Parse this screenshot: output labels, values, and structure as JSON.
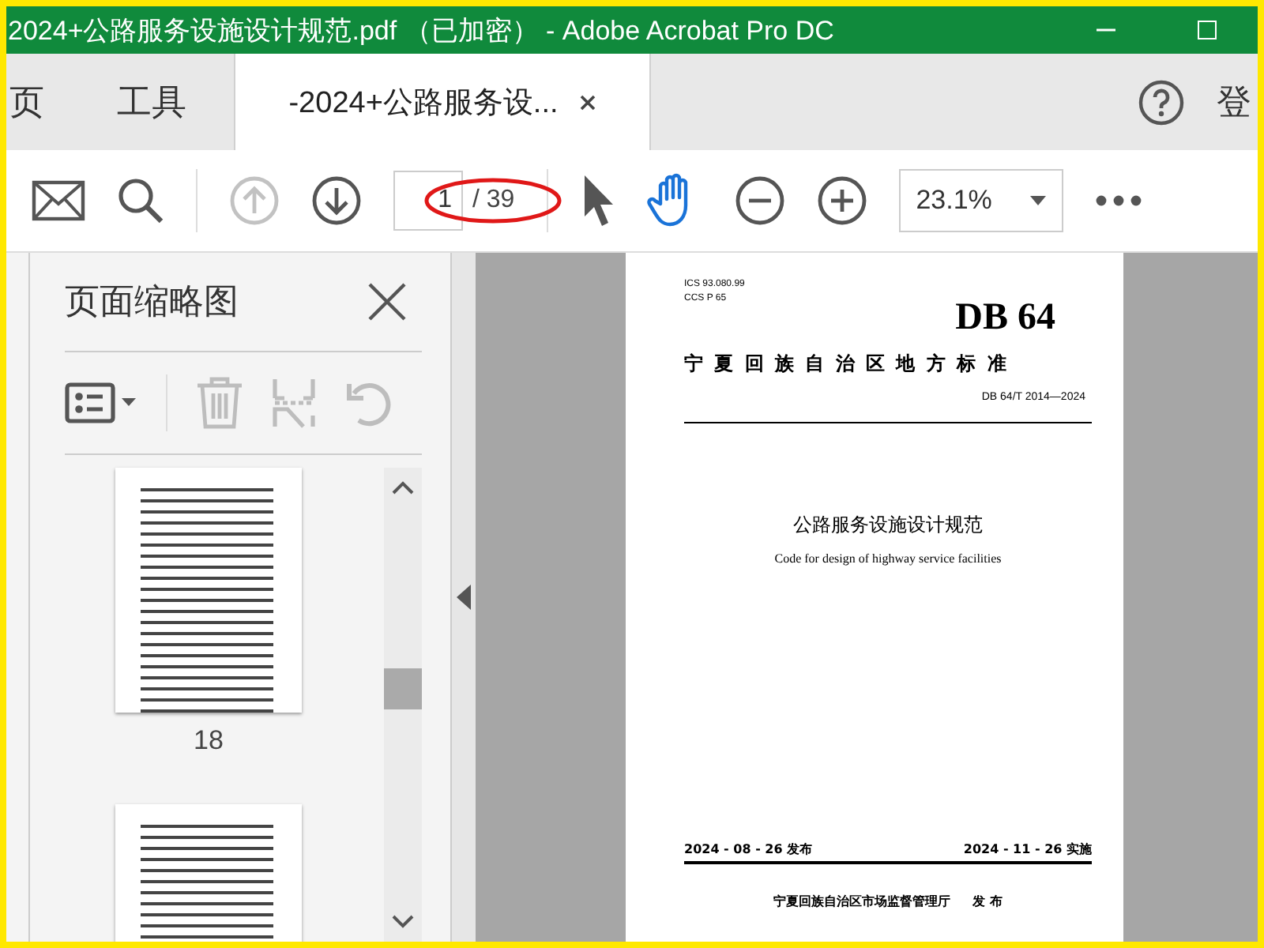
{
  "window": {
    "title": "2024+公路服务设施设计规范.pdf （已加密） - Adobe Acrobat Pro DC"
  },
  "tabs": [
    {
      "label": "页",
      "kind": "nav",
      "selected": false
    },
    {
      "label": "工具",
      "kind": "nav",
      "selected": false
    },
    {
      "label": "-2024+公路服务设...",
      "kind": "doc",
      "selected": true
    }
  ],
  "account_label": "登",
  "toolbar": {
    "prev_page_disabled": true,
    "page_field": {
      "value": "1"
    },
    "page_count": "/ 39",
    "hand_tool_selected": true,
    "zoom": "23.1%",
    "annotation_circle": true
  },
  "thumbnail_panel": {
    "title": "页面缩略图",
    "tools_disabled": true,
    "thumbnails": [
      {
        "label": "18",
        "selected": false
      },
      {
        "selected": false
      }
    ]
  },
  "document": {
    "ics": "ICS  93.080.99",
    "ccs": "CCS  P 65",
    "logo": "DB 64",
    "standard_type": "宁 夏 回 族 自 治 区 地 方 标 准",
    "standard_number": "DB 64/T 2014—2024",
    "title": "公路服务设施设计规范",
    "subtitle": "Code for design of highway service facilities",
    "issue_date": "2024 - 08 - 26 发布",
    "effective_date": "2024 - 11 - 26 实施",
    "issuer": "宁夏回族自治区市场监督管理厅",
    "issue_word": "发  布"
  }
}
